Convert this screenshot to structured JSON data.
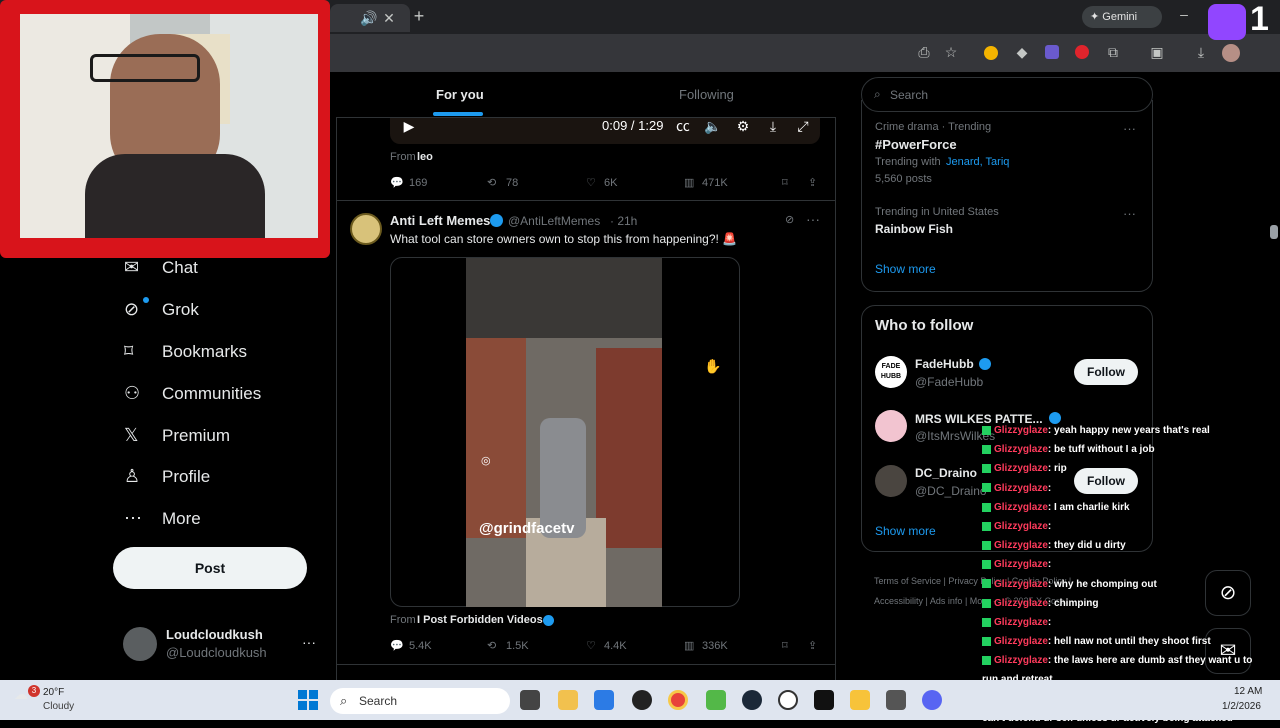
{
  "browser": {
    "gemini_label": "Gemini",
    "tab_icons": [
      "speaker-icon",
      "close-icon",
      "plus-icon"
    ]
  },
  "feed": {
    "tabs": [
      {
        "label": "For you",
        "active": true
      },
      {
        "label": "Following",
        "active": false
      }
    ],
    "video_time": "0:09 / 1:29",
    "post1": {
      "from_label": "From",
      "from_name": "leo",
      "replies": "169",
      "reposts": "78",
      "likes": "6K",
      "views": "471K"
    },
    "post2": {
      "author": "Anti Left Memes",
      "handle": "@AntiLeftMemes",
      "time": "· 21h",
      "text": "What tool can store owners own to stop this from happening?! 🚨",
      "watermark": "@grindfacetv",
      "from_label": "From",
      "from_name": "I Post Forbidden Videos",
      "replies": "5.4K",
      "reposts": "1.5K",
      "likes": "4.4K",
      "views": "336K"
    }
  },
  "nav": {
    "items": [
      {
        "label": "Chat",
        "icon": "mail-icon"
      },
      {
        "label": "Grok",
        "icon": "grok-icon"
      },
      {
        "label": "Bookmarks",
        "icon": "bookmark-icon"
      },
      {
        "label": "Communities",
        "icon": "communities-icon"
      },
      {
        "label": "Premium",
        "icon": "x-icon"
      },
      {
        "label": "Profile",
        "icon": "person-icon"
      },
      {
        "label": "More",
        "icon": "more-icon"
      }
    ],
    "post_label": "Post",
    "user": {
      "name": "Loudcloudkush",
      "handle": "@Loudcloudkush"
    }
  },
  "right": {
    "search_placeholder": "Search",
    "trends": [
      {
        "context": "Crime drama · Trending",
        "name": "#PowerForce",
        "with_label": "Trending with",
        "with": "Jenard, Tariq",
        "posts": "5,560 posts"
      },
      {
        "context": "Trending in United States",
        "name": "Rainbow Fish"
      }
    ],
    "show_more": "Show more",
    "who_to_follow": "Who to follow",
    "suggestions": [
      {
        "name": "FadeHubb",
        "handle": "@FadeHubb",
        "logo": "FADE HUBB"
      },
      {
        "name": "MRS WILKES PATTE...",
        "handle": "@ItsMrsWilkes"
      },
      {
        "name": "DC_Draino",
        "handle": "@DC_Draino"
      }
    ],
    "follow_label": "Follow",
    "show_more_2": "Show more",
    "footer": [
      "Terms of Service",
      "|",
      "Privacy Policy",
      "|",
      "Cookie Policy",
      "|",
      "Accessibility",
      "|",
      "Ads info",
      "|",
      "More ···",
      "© 2025 X Corp."
    ]
  },
  "chat": [
    {
      "user": "Glizzyglaze",
      "msg": ": yeah happy new years that's real"
    },
    {
      "user": "Glizzyglaze",
      "msg": ": be tuff without I a job"
    },
    {
      "user": "Glizzyglaze",
      "msg": ": rip"
    },
    {
      "user": "Glizzyglaze",
      "msg": ": "
    },
    {
      "user": "Glizzyglaze",
      "msg": ": I am charlie kirk"
    },
    {
      "user": "Glizzyglaze",
      "msg": ": "
    },
    {
      "user": "Glizzyglaze",
      "msg": ": they did u dirty"
    },
    {
      "user": "Glizzyglaze",
      "msg": ": "
    },
    {
      "user": "Glizzyglaze",
      "msg": ": why he chomping out"
    },
    {
      "user": "Glizzyglaze",
      "msg": ": chimping"
    },
    {
      "user": "Glizzyglaze",
      "msg": ": "
    },
    {
      "user": "Glizzyglaze",
      "msg": ": hell naw not until they shoot first"
    },
    {
      "user": "Glizzyglaze",
      "msg": ": the laws here are dumb asf they want u to"
    },
    {
      "user": "",
      "msg": "run and retreat"
    },
    {
      "user": "Glizzyglaze",
      "msg": ": castle doctrine law make it to where u"
    },
    {
      "user": "",
      "msg": "can't defend ur self unless ur actively being attacked"
    }
  ],
  "taskbar": {
    "weather_temp": "20°F",
    "weather_desc": "Cloudy",
    "weather_badge": "3",
    "search_label": "Search",
    "time": "12 AM",
    "date": "1/2/2026"
  },
  "colors": {
    "accent": "#1d9bf0",
    "webcam_border": "#d8141b",
    "twitch": "#9146ff"
  }
}
